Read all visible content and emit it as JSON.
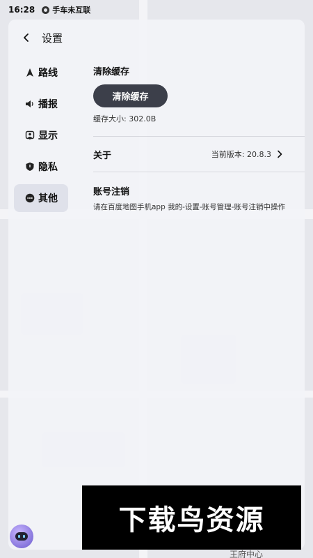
{
  "status_bar": {
    "time": "16:28",
    "carrier": "手车未互联"
  },
  "header": {
    "title": "设置",
    "back_icon": "chevron-left-icon"
  },
  "nav": {
    "items": [
      {
        "label": "路线",
        "icon": "navigation-arrow-icon",
        "active": false
      },
      {
        "label": "播报",
        "icon": "speaker-icon",
        "active": false
      },
      {
        "label": "显示",
        "icon": "person-pin-icon",
        "active": false
      },
      {
        "label": "隐私",
        "icon": "shield-icon",
        "active": false
      },
      {
        "label": "其他",
        "icon": "more-dots-icon",
        "active": true
      }
    ]
  },
  "cache": {
    "title": "清除缓存",
    "button_label": "清除缓存",
    "size_text": "缓存大小: 302.0B"
  },
  "about": {
    "label": "关于",
    "version_text": "当前版本: 20.8.3"
  },
  "account": {
    "title": "账号注销",
    "description": "请在百度地图手机app 我的-设置-账号管理-账号注销中操作"
  },
  "watermark": {
    "text": "下载鸟资源"
  },
  "map": {
    "bottom_label": "王府中心"
  },
  "colors": {
    "button_bg": "#3c3f4a",
    "panel_bg": "#f2f3f8",
    "active_nav_bg": "#dfe1ea"
  }
}
